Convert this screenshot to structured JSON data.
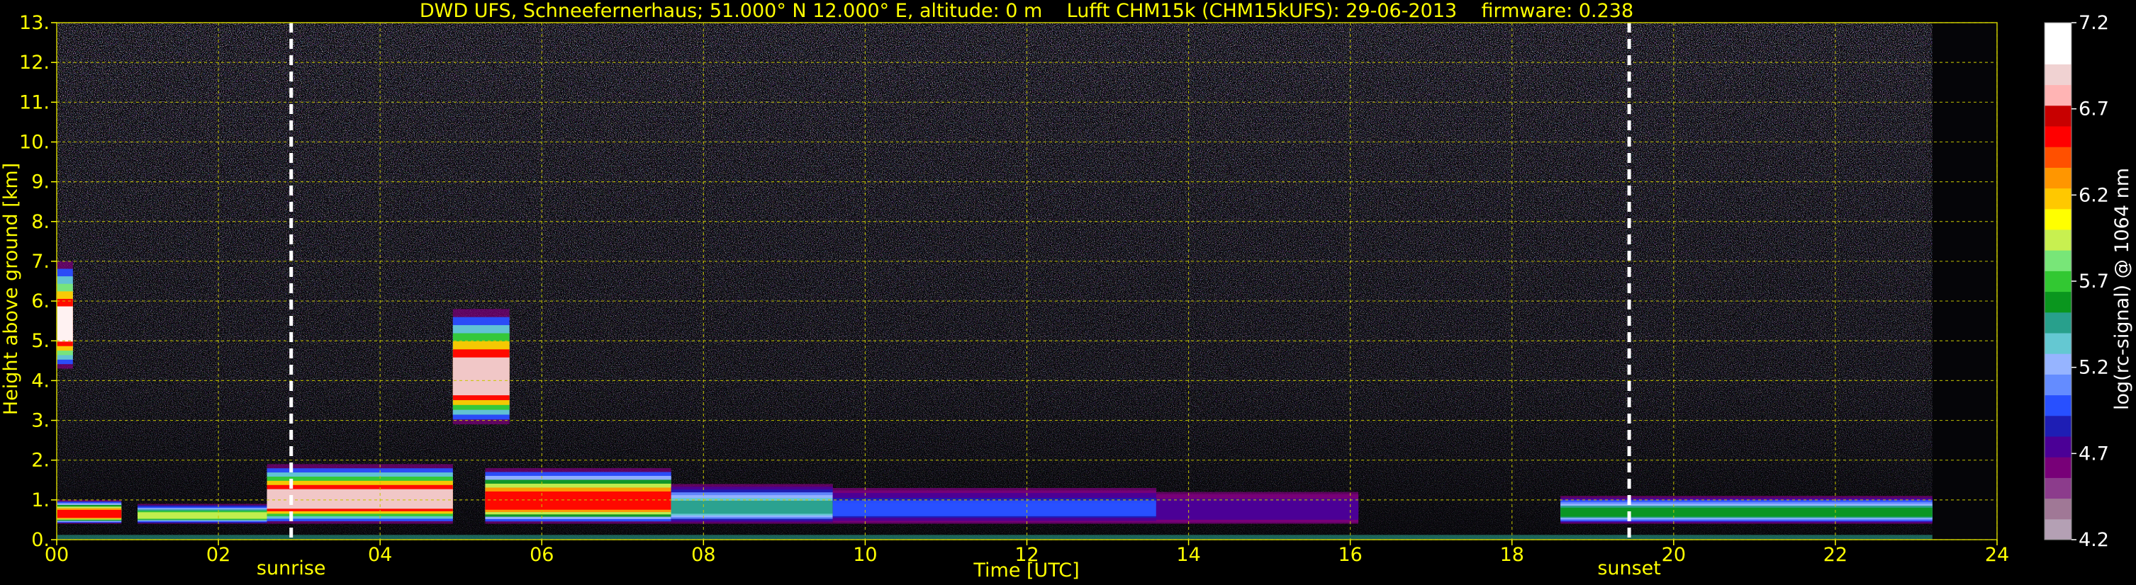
{
  "chart_data": {
    "type": "heatmap",
    "title": "DWD UFS, Schneefernerhaus; 51.000° N 12.000° E, altitude: 0 m    Lufft CHM15k (CHM15kUFS): 29-06-2013    firmware: 0.238",
    "xlabel": "Time [UTC]",
    "ylabel": "Height above ground [km]",
    "xlim": [
      0,
      24
    ],
    "ylim": [
      0,
      13
    ],
    "x_ticks": [
      "00",
      "02",
      "04",
      "06",
      "08",
      "10",
      "12",
      "14",
      "16",
      "18",
      "20",
      "22",
      "24"
    ],
    "y_ticks": [
      "0.",
      "1.",
      "2.",
      "3.",
      "4.",
      "5.",
      "6.",
      "7.",
      "8.",
      "9.",
      "10.",
      "11.",
      "12.",
      "13."
    ],
    "grid": true,
    "data_end_hour": 23.2,
    "events": [
      {
        "label": "sunrise",
        "hour": 2.9
      },
      {
        "label": "sunset",
        "hour": 19.45
      }
    ],
    "colorbar": {
      "label": "log(rc-signal) @ 1064 nm",
      "range": [
        4.2,
        7.2
      ],
      "ticks": [
        "4.2",
        "4.7",
        "5.2",
        "5.7",
        "6.2",
        "6.7",
        "7.2"
      ],
      "colors": [
        "#b4a0b4",
        "#a07896",
        "#8c3c8c",
        "#780078",
        "#4b0096",
        "#1e1eb4",
        "#2850ff",
        "#648cff",
        "#96b4ff",
        "#64c8d2",
        "#28a08c",
        "#0a961e",
        "#32c832",
        "#78e678",
        "#c8f050",
        "#ffff00",
        "#ffc800",
        "#ff9600",
        "#ff5000",
        "#ff0000",
        "#c80000",
        "#ffb4b4",
        "#f0d2d2",
        "#ffffff",
        "#ffffff"
      ]
    },
    "features": [
      {
        "name": "upper cloud",
        "t0": 0.0,
        "t1": 0.2,
        "h0": 4.3,
        "h1": 7.0,
        "peak": 7.0
      },
      {
        "name": "upper cloud",
        "t0": 4.9,
        "t1": 5.6,
        "h0": 2.9,
        "h1": 5.8,
        "peak": 6.9
      },
      {
        "name": "boundary layer",
        "t0": 0.0,
        "t1": 0.8,
        "h0": 0.4,
        "h1": 1.0,
        "peak": 6.6
      },
      {
        "name": "boundary layer",
        "t0": 1.0,
        "t1": 2.6,
        "h0": 0.4,
        "h1": 0.9,
        "peak": 5.9
      },
      {
        "name": "boundary layer",
        "t0": 2.6,
        "t1": 4.9,
        "h0": 0.4,
        "h1": 1.9,
        "peak": 6.9
      },
      {
        "name": "boundary layer",
        "t0": 5.3,
        "t1": 7.6,
        "h0": 0.4,
        "h1": 1.8,
        "peak": 6.6
      },
      {
        "name": "boundary layer",
        "t0": 7.6,
        "t1": 9.6,
        "h0": 0.4,
        "h1": 1.4,
        "peak": 5.5
      },
      {
        "name": "boundary layer",
        "t0": 9.6,
        "t1": 13.6,
        "h0": 0.4,
        "h1": 1.3,
        "peak": 5.0
      },
      {
        "name": "boundary layer",
        "t0": 13.6,
        "t1": 16.1,
        "h0": 0.4,
        "h1": 1.2,
        "peak": 4.8
      },
      {
        "name": "boundary layer",
        "t0": 18.6,
        "t1": 23.2,
        "h0": 0.4,
        "h1": 1.1,
        "peak": 5.6
      }
    ]
  }
}
